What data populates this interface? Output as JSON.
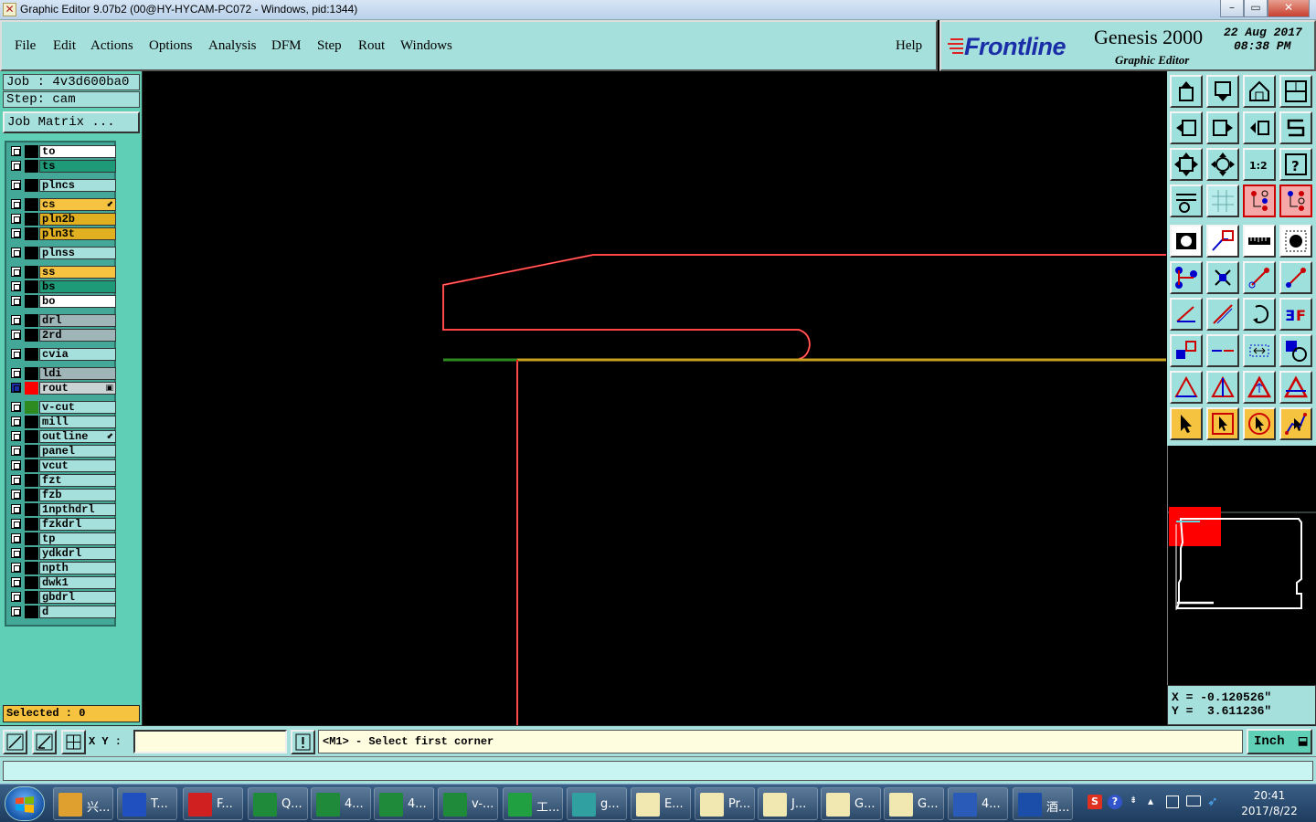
{
  "window": {
    "title": "Graphic Editor 9.07b2 (00@HY-HYCAM-PC072 - Windows, pid:1344)",
    "min_glyph": "–",
    "max_glyph": "▭",
    "close_glyph": "✕"
  },
  "menu": {
    "items": [
      {
        "label": "File"
      },
      {
        "label": "Edit"
      },
      {
        "label": "Actions"
      },
      {
        "label": "Options"
      },
      {
        "label": "Analysis"
      },
      {
        "label": "DFM"
      },
      {
        "label": "Step"
      },
      {
        "label": "Rout"
      },
      {
        "label": "Windows"
      }
    ],
    "help": "Help"
  },
  "brand": {
    "logo": "Frontline",
    "product": "Genesis 2000",
    "subtitle": "Graphic Editor",
    "date": "22 Aug 2017",
    "time": "08:38 PM"
  },
  "job": {
    "job_line": "Job : 4v3d600ba0",
    "step_line": "Step: cam",
    "matrix_button": "Job Matrix ..."
  },
  "layers": [
    {
      "name": "to",
      "color": "#ffffff"
    },
    {
      "name": "ts",
      "color": "#1e9a78"
    },
    {
      "name": "plncs",
      "color": "#a6e0dc"
    },
    {
      "name": "cs",
      "color": "#f6c340",
      "mark": "⬋"
    },
    {
      "name": "pln2b",
      "color": "#e0b020"
    },
    {
      "name": "pln3t",
      "color": "#e0b020"
    },
    {
      "name": "plnss",
      "color": "#a6e0dc"
    },
    {
      "name": "ss",
      "color": "#f6c340"
    },
    {
      "name": "bs",
      "color": "#1e9a78"
    },
    {
      "name": "bo",
      "color": "#ffffff"
    },
    {
      "name": "drl",
      "color": "#9fb5b8"
    },
    {
      "name": "2rd",
      "color": "#9fb5b8"
    },
    {
      "name": "cvia",
      "color": "#a6e0dc"
    },
    {
      "name": "ldi",
      "color": "#9fb5b8"
    },
    {
      "name": "rout",
      "color": "#c9d3d3",
      "swatch": "#ff0000",
      "active": true,
      "mark": "▣"
    },
    {
      "name": "v-cut",
      "color": "#a6e0dc",
      "swatch": "#2e8b22"
    },
    {
      "name": "mill",
      "color": "#a6e0dc"
    },
    {
      "name": "outline",
      "color": "#a6e0dc",
      "mark": "⬋"
    },
    {
      "name": "panel",
      "color": "#a6e0dc"
    },
    {
      "name": "vcut",
      "color": "#a6e0dc"
    },
    {
      "name": "fzt",
      "color": "#a6e0dc"
    },
    {
      "name": "fzb",
      "color": "#a6e0dc"
    },
    {
      "name": "1npthdrl",
      "color": "#a6e0dc"
    },
    {
      "name": "fzkdrl",
      "color": "#a6e0dc"
    },
    {
      "name": "tp",
      "color": "#a6e0dc"
    },
    {
      "name": "ydkdrl",
      "color": "#a6e0dc"
    },
    {
      "name": "npth",
      "color": "#a6e0dc"
    },
    {
      "name": "dwk1",
      "color": "#a6e0dc"
    },
    {
      "name": "gbdrl",
      "color": "#a6e0dc"
    },
    {
      "name": "d",
      "color": "#a6e0dc"
    }
  ],
  "selected": "Selected : 0",
  "coords": {
    "x": "X = -0.120526\"",
    "y": "Y =  3.611236\""
  },
  "command": {
    "xy_label": "X Y :",
    "xy_value": "",
    "prompt": "<M1> - Select first corner",
    "unit": "Inch",
    "unit_glyph": "⬓"
  },
  "colors": {
    "rout": "#ff2020",
    "vcut": "#2e8b22",
    "outline": "#c8a020",
    "panel_bg": "#a6e0dc",
    "panel_dark": "#5fcfb5"
  },
  "taskbar": {
    "tasks": [
      {
        "label": "兴...",
        "icon": "flower-icon",
        "color": "#e0a030"
      },
      {
        "label": "T...",
        "icon": "floppy-icon",
        "color": "#2050c0"
      },
      {
        "label": "F...",
        "icon": "foxit-icon",
        "color": "#d02020"
      },
      {
        "label": "Q...",
        "icon": "excel-icon",
        "color": "#1e8a3a"
      },
      {
        "label": "4...",
        "icon": "excel-icon",
        "color": "#1e8a3a"
      },
      {
        "label": "4...",
        "icon": "excel-icon",
        "color": "#1e8a3a"
      },
      {
        "label": "v-...",
        "icon": "excel-icon",
        "color": "#1e8a3a"
      },
      {
        "label": "工...",
        "icon": "frontline-icon",
        "color": "#20a040"
      },
      {
        "label": "g...",
        "icon": "eye-icon",
        "color": "#30a0a0"
      },
      {
        "label": "E...",
        "icon": "genesis-icon",
        "color": "#f0e8b0"
      },
      {
        "label": "Pr...",
        "icon": "genesis-icon",
        "color": "#f0e8b0"
      },
      {
        "label": "J...",
        "icon": "genesis-icon",
        "color": "#f0e8b0"
      },
      {
        "label": "G...",
        "icon": "genesis-icon",
        "color": "#f0e8b0"
      },
      {
        "label": "G...",
        "icon": "genesis-icon",
        "color": "#f0e8b0"
      },
      {
        "label": "4...",
        "icon": "word-icon",
        "color": "#2b5bb8"
      },
      {
        "label": "酒...",
        "icon": "frontline-f-icon",
        "color": "#1a4ea8"
      }
    ],
    "clock_time": "20:41",
    "clock_date": "2017/8/22"
  }
}
